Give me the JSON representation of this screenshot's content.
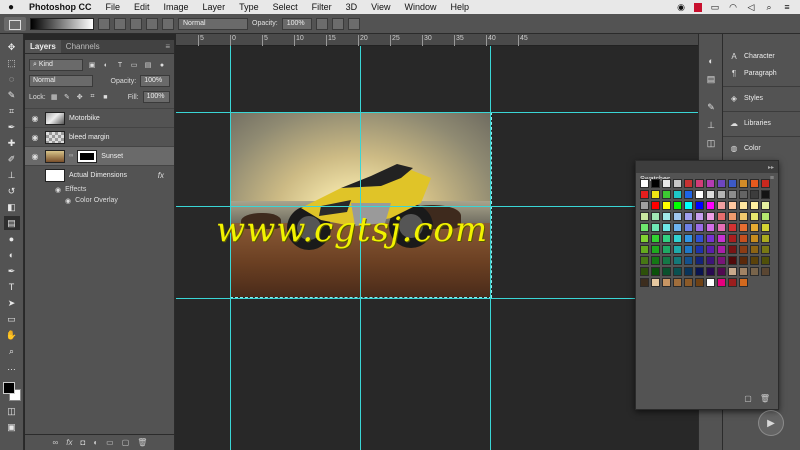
{
  "menubar": {
    "apple_icon": "apple-icon",
    "items": [
      "Photoshop CC",
      "File",
      "Edit",
      "Image",
      "Layer",
      "Type",
      "Select",
      "Filter",
      "3D",
      "View",
      "Window",
      "Help"
    ]
  },
  "options": {
    "blend_mode": "Normal",
    "opacity_label": "Opacity:",
    "opacity_value": "100%"
  },
  "layers_panel": {
    "tabs": [
      "Layers",
      "Channels"
    ],
    "filter_kind": "Kind",
    "blend_mode": "Normal",
    "opacity_label": "Opacity:",
    "opacity_value": "100%",
    "lock_label": "Lock:",
    "fill_label": "Fill:",
    "fill_value": "100%",
    "layers": [
      {
        "name": "Motorbike"
      },
      {
        "name": "bleed margin"
      },
      {
        "name": "Sunset"
      },
      {
        "name": "Actual Dimensions",
        "fx": "fx"
      }
    ],
    "effects_label": "Effects",
    "effect_item": "Color Overlay"
  },
  "ruler": {
    "ticks": [
      "5",
      "0",
      "5",
      "10",
      "15",
      "20",
      "25",
      "30",
      "35",
      "40",
      "45"
    ]
  },
  "canvas": {
    "watermark": "www.cgtsj.com"
  },
  "right_panels": {
    "items": [
      "Character",
      "Paragraph",
      "Styles",
      "Libraries",
      "Color"
    ]
  },
  "swatches": {
    "title": "Swatches",
    "colors": [
      "#ffffff",
      "#000000",
      "#e6e6e6",
      "#c8c8c8",
      "#c83232",
      "#d23c78",
      "#b43cb4",
      "#6e46be",
      "#3c5ac8",
      "#d28c28",
      "#e65a1e",
      "#c8281e",
      "#e61e1e",
      "#f0e614",
      "#3cc832",
      "#1ec8c8",
      "#1e64e6",
      "#ffffff",
      "#dcdcdc",
      "#b4b4b4",
      "#8c8c8c",
      "#646464",
      "#3c3c3c",
      "#141414",
      "#a0a0a0",
      "#ff0000",
      "#ffff00",
      "#00ff00",
      "#00ffff",
      "#0000ff",
      "#ff00ff",
      "#f0a0a0",
      "#ffc8a0",
      "#ffe6a0",
      "#fff0a0",
      "#e6f0a0",
      "#c8e6a0",
      "#a0e6b4",
      "#a0e6e6",
      "#a0c8f0",
      "#a0a0f0",
      "#c8a0f0",
      "#f0a0e6",
      "#e66e6e",
      "#f09b6e",
      "#f0c86e",
      "#e6e66e",
      "#b4e66e",
      "#6ee66e",
      "#6ee6b4",
      "#6ee6e6",
      "#6eb4f0",
      "#6e82e6",
      "#9b6ee6",
      "#d26ee6",
      "#e66eb4",
      "#d23232",
      "#e66e32",
      "#e6aa32",
      "#d2d232",
      "#82d232",
      "#32d232",
      "#32d282",
      "#32d2d2",
      "#3296e6",
      "#3250d2",
      "#7832d2",
      "#c832d2",
      "#aa1e1e",
      "#c8501e",
      "#c88c1e",
      "#aaaa1e",
      "#64aa1e",
      "#1eaa1e",
      "#1eaa64",
      "#1eaaaa",
      "#1e78c8",
      "#1e32aa",
      "#5a1eaa",
      "#aa1eaa",
      "#781414",
      "#8c3c14",
      "#8c6414",
      "#787814",
      "#467814",
      "#147814",
      "#147846",
      "#147878",
      "#14508c",
      "#142378",
      "#3c1478",
      "#781478",
      "#500a0a",
      "#5a280a",
      "#5a420a",
      "#50500a",
      "#2d500a",
      "#0a500a",
      "#0a502d",
      "#0a5050",
      "#0a345a",
      "#0a1450",
      "#280a50",
      "#500a50",
      "#c8aa8c",
      "#a08264",
      "#78644b",
      "#5a4632",
      "#3c2d1e",
      "#e6c8a0",
      "#c89664",
      "#a06e3c",
      "#8c5a28",
      "#6e4114",
      "#ffffff",
      "#e6007e",
      "#9b1e1e",
      "#d2691e"
    ]
  },
  "icons": {
    "tools": [
      "move-icon",
      "marquee-icon",
      "lasso-icon",
      "quick-select-icon",
      "crop-icon",
      "eyedropper-icon",
      "healing-icon",
      "brush-icon",
      "stamp-icon",
      "history-brush-icon",
      "eraser-icon",
      "gradient-icon",
      "blur-icon",
      "dodge-icon",
      "pen-icon",
      "type-icon",
      "path-select-icon",
      "rectangle-icon",
      "hand-icon",
      "zoom-icon"
    ]
  }
}
